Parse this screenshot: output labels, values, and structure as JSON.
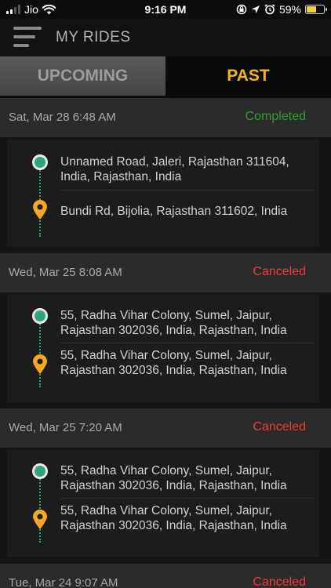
{
  "status_bar": {
    "carrier": "Jio",
    "time": "9:16 PM",
    "battery_percent": "59%",
    "battery_level": 0.59,
    "icons": [
      "signal-icon",
      "wifi-icon",
      "screen-lock-icon",
      "location-arrow-icon",
      "alarm-icon",
      "battery-icon"
    ]
  },
  "header": {
    "title": "MY RIDES",
    "menu_icon": "hamburger-menu-icon"
  },
  "tabs": [
    {
      "label": "UPCOMING",
      "active": false
    },
    {
      "label": "PAST",
      "active": true
    }
  ],
  "colors": {
    "accent": "#f2b51d",
    "completed": "#2f9e2f",
    "canceled": "#f03b3b",
    "route_green": "#2fa37a",
    "pin_orange": "#f5a623"
  },
  "rides": [
    {
      "date": "Sat, Mar 28 6:48 AM",
      "status": "Completed",
      "pickup": "Unnamed Road, Jaleri, Rajasthan 311604, India, Rajasthan, India",
      "dropoff": "Bundi Rd, Bijolia, Rajasthan 311602, India"
    },
    {
      "date": "Wed, Mar 25 8:08 AM",
      "status": "Canceled",
      "pickup": "55, Radha Vihar Colony, Sumel, Jaipur, Rajasthan 302036, India, Rajasthan, India",
      "dropoff": "55, Radha Vihar Colony, Sumel, Jaipur, Rajasthan 302036, India, Rajasthan, India"
    },
    {
      "date": "Wed, Mar 25 7:20 AM",
      "status": "Canceled",
      "pickup": "55, Radha Vihar Colony, Sumel, Jaipur, Rajasthan 302036, India, Rajasthan, India",
      "dropoff": "55, Radha Vihar Colony, Sumel, Jaipur, Rajasthan 302036, India, Rajasthan, India"
    },
    {
      "date": "Tue, Mar 24 9:07 AM",
      "status": "Canceled",
      "pickup": "",
      "dropoff": ""
    }
  ]
}
